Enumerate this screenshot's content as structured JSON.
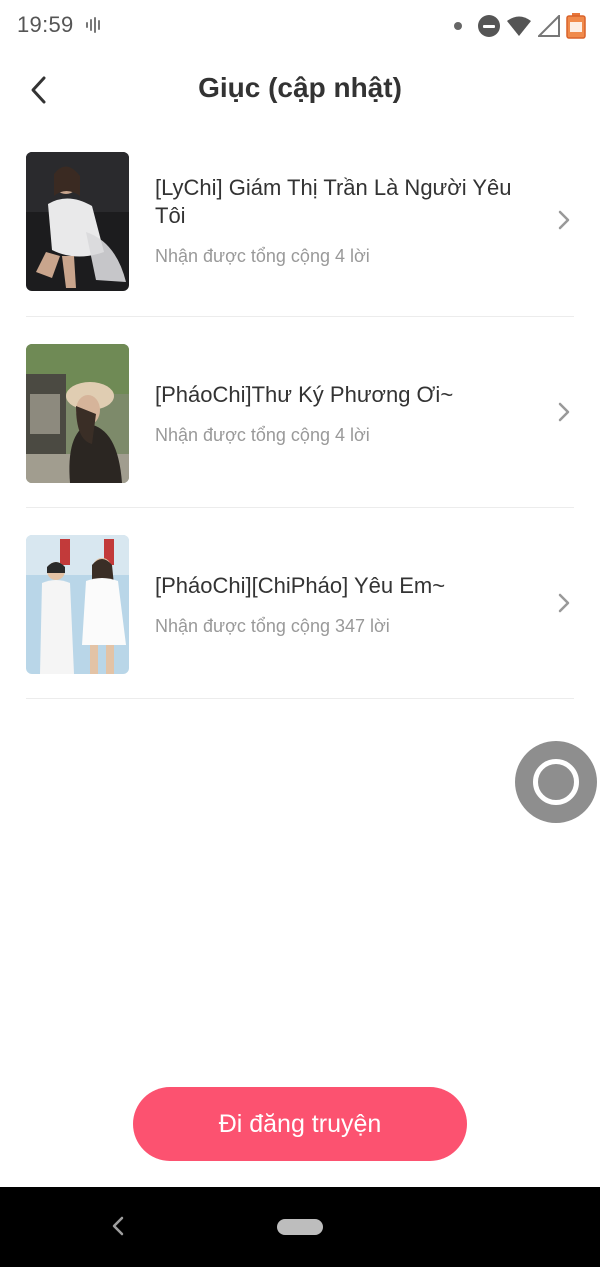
{
  "status_bar": {
    "time": "19:59",
    "icons": [
      "voice-wave-icon",
      "notification-dot-icon",
      "do-not-disturb-icon",
      "wifi-icon",
      "signal-icon",
      "battery-icon"
    ]
  },
  "header": {
    "title": "Giục (cập nhật)",
    "back_icon": "chevron-left-icon"
  },
  "stories": [
    {
      "title": "[LyChi] Giám Thị Trần Là Người Yêu Tôi",
      "subtitle": "Nhận được tổng cộng 4 lời"
    },
    {
      "title": "[PháoChi]Thư Ký Phương Ơi~",
      "subtitle": "Nhận được tổng cộng 4 lời"
    },
    {
      "title": "[PháoChi][ChiPháo] Yêu Em~",
      "subtitle": "Nhận được tổng cộng 347 lời"
    }
  ],
  "actions": {
    "post_story_label": "Đi đăng truyện"
  },
  "colors": {
    "accent": "#fc5270",
    "floating_button": "#8e8e8e",
    "nav_bar": "#000000"
  }
}
